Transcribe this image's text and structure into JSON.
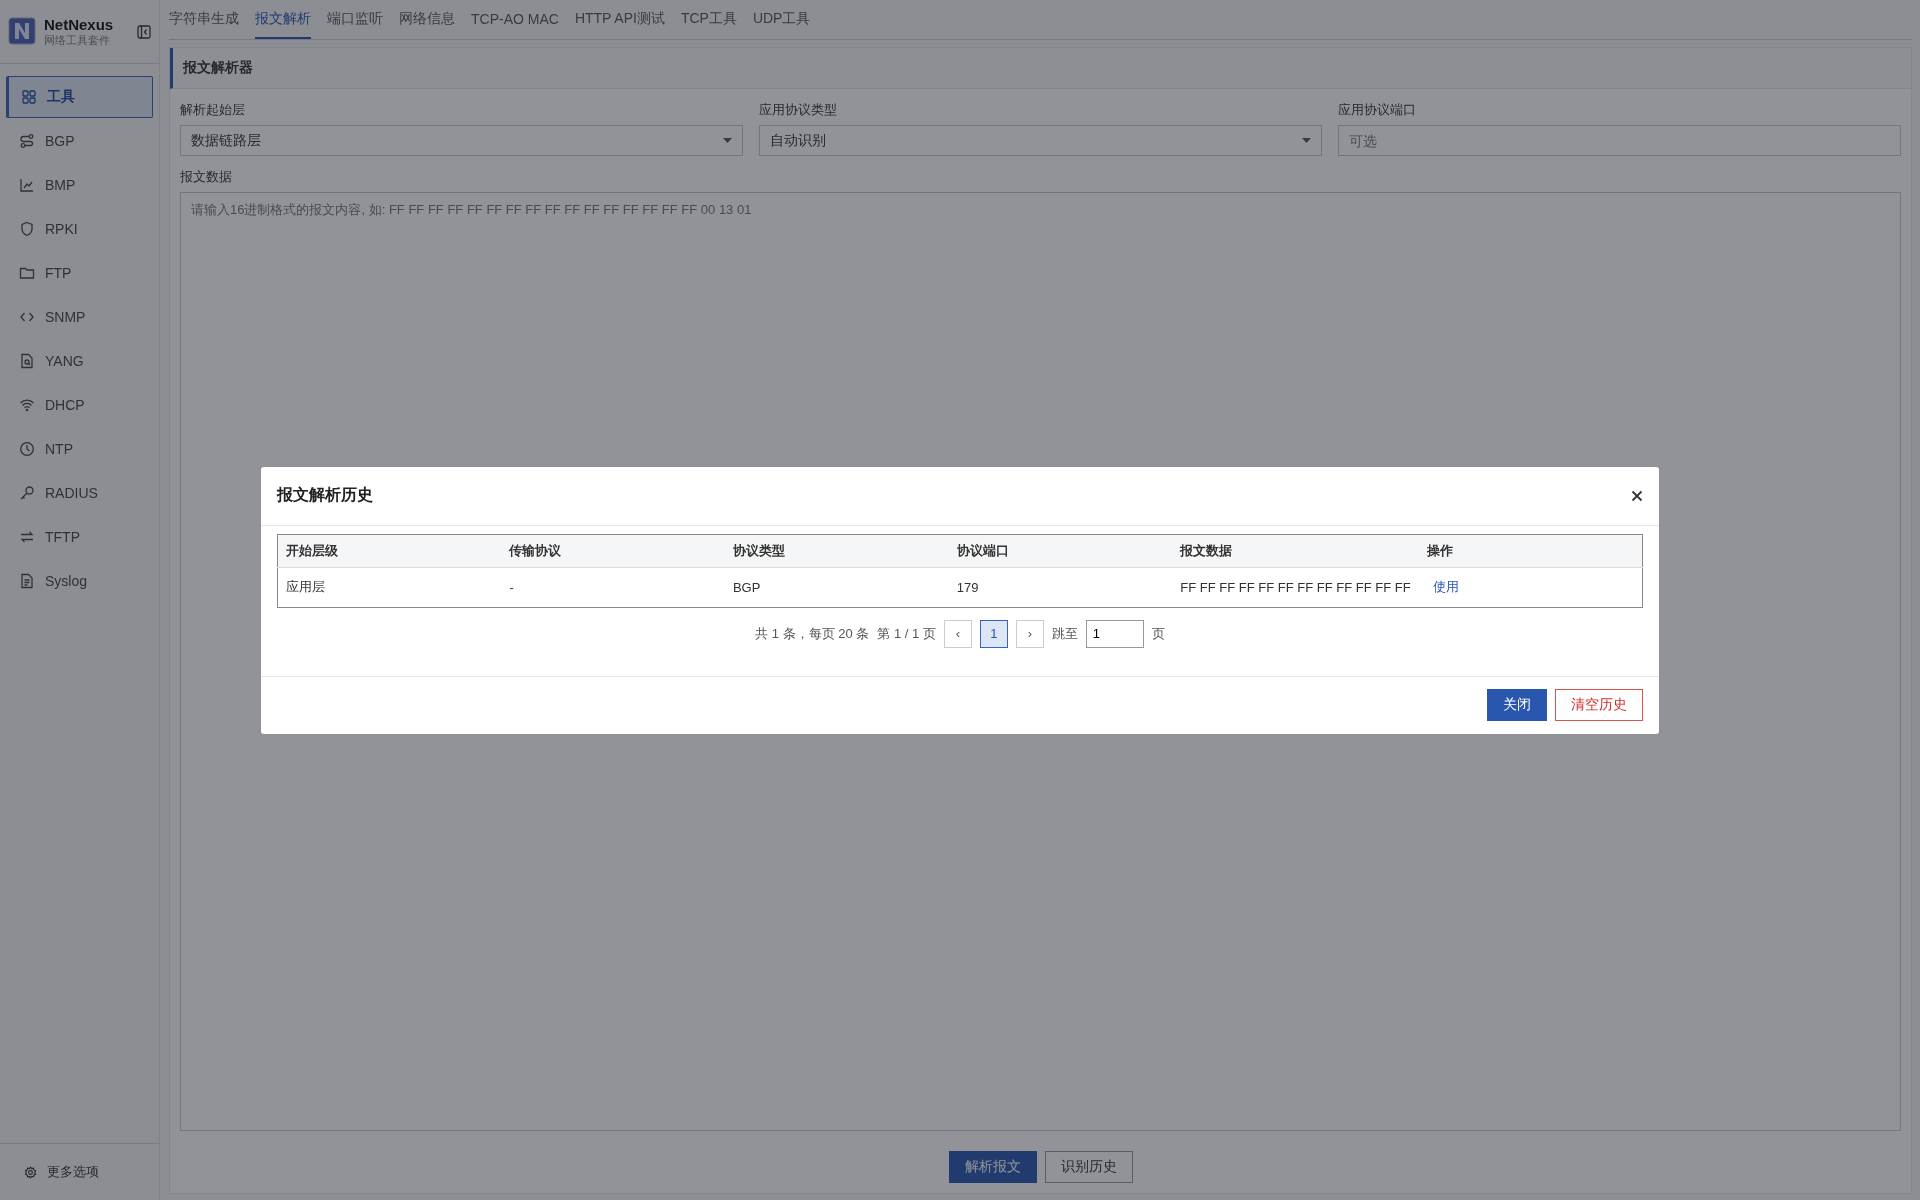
{
  "app": {
    "name": "NetNexus",
    "subtitle": "网络工具套件"
  },
  "sidebar": {
    "items": [
      {
        "label": "工具",
        "selected": true
      },
      {
        "label": "BGP",
        "selected": false
      },
      {
        "label": "BMP",
        "selected": false
      },
      {
        "label": "RPKI",
        "selected": false
      },
      {
        "label": "FTP",
        "selected": false
      },
      {
        "label": "SNMP",
        "selected": false
      },
      {
        "label": "YANG",
        "selected": false
      },
      {
        "label": "DHCP",
        "selected": false
      },
      {
        "label": "NTP",
        "selected": false
      },
      {
        "label": "RADIUS",
        "selected": false
      },
      {
        "label": "TFTP",
        "selected": false
      },
      {
        "label": "Syslog",
        "selected": false
      }
    ],
    "footer": "更多选项"
  },
  "tabs": [
    {
      "label": "字符串生成",
      "selected": false
    },
    {
      "label": "报文解析",
      "selected": true
    },
    {
      "label": "端口监听",
      "selected": false
    },
    {
      "label": "网络信息",
      "selected": false
    },
    {
      "label": "TCP-AO MAC",
      "selected": false
    },
    {
      "label": "HTTP API测试",
      "selected": false
    },
    {
      "label": "TCP工具",
      "selected": false
    },
    {
      "label": "UDP工具",
      "selected": false
    }
  ],
  "panel": {
    "title": "报文解析器",
    "fields": [
      {
        "label": "解析起始层",
        "kind": "select",
        "value": "数据链路层"
      },
      {
        "label": "应用协议类型",
        "kind": "select",
        "value": "自动识别"
      },
      {
        "label": "应用协议端口",
        "kind": "input",
        "placeholder": "可选"
      }
    ],
    "data": {
      "label": "报文数据",
      "placeholder": "请输入16进制格式的报文内容, 如: FF FF FF FF FF FF FF FF FF FF FF FF FF FF FF FF 00 13 01"
    },
    "buttons": [
      {
        "label": "解析报文",
        "kind": "primary"
      },
      {
        "label": "识别历史",
        "kind": "default"
      }
    ]
  },
  "dialog": {
    "title": "报文解析历史",
    "table": {
      "columns": [
        "开始层级",
        "传输协议",
        "协议类型",
        "协议端口",
        "报文数据",
        "操作"
      ],
      "rows": [
        {
          "cells": [
            "应用层",
            "-",
            "BGP",
            "179",
            "FF FF FF FF FF FF FF FF FF FF FF FF"
          ],
          "action": "使用"
        }
      ]
    },
    "pagination": {
      "summary": "共 1 条，每页 20 条",
      "pages_info": "第 1 / 1 页",
      "prev": "‹",
      "pages": [
        {
          "label": "1",
          "selected": true
        }
      ],
      "next": "›",
      "jump_label": "跳至",
      "jump_value": "1",
      "jump_suffix": "页"
    },
    "buttons": [
      {
        "label": "关闭",
        "kind": "primary"
      },
      {
        "label": "清空历史",
        "kind": "danger"
      }
    ]
  }
}
